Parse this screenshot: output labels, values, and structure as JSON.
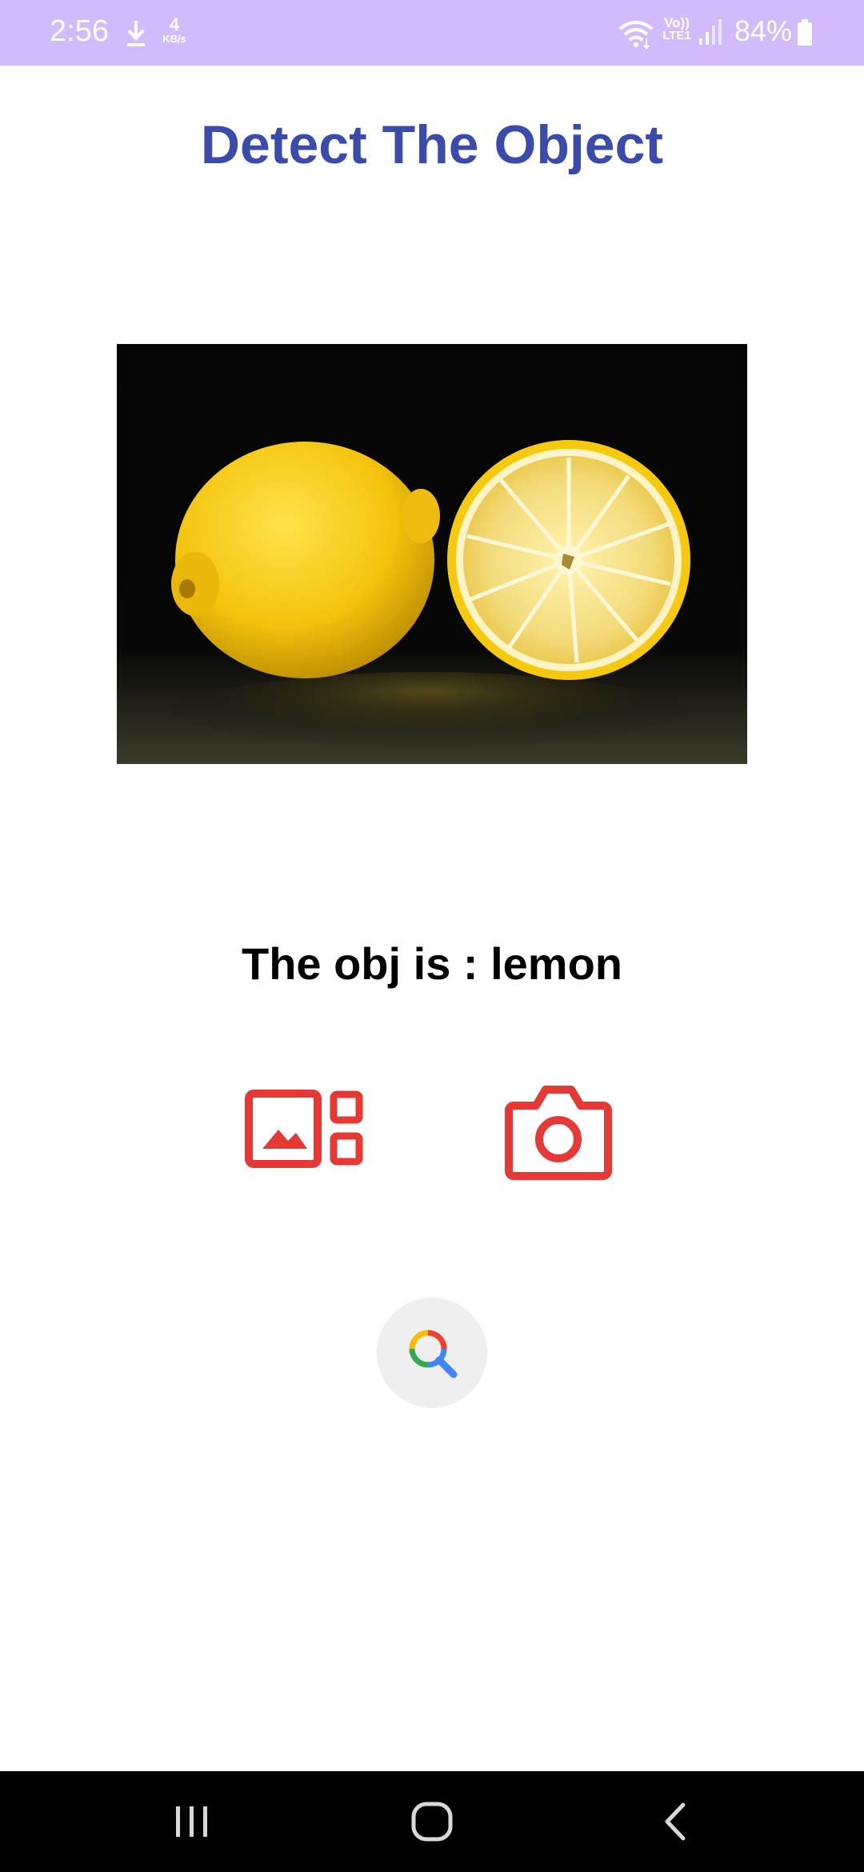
{
  "status_bar": {
    "time": "2:56",
    "speed_value": "4",
    "speed_unit": "KB/s",
    "volte_top": "Vo))",
    "volte_bottom": "LTE1",
    "battery": "84%",
    "background_color": "#d0bcfc"
  },
  "header": {
    "title": "Detect The Object",
    "title_color": "#3a4bab"
  },
  "main": {
    "image_subject": "lemon-photo",
    "result_text": "The obj is : lemon",
    "gallery_icon": "gallery-icon",
    "camera_icon": "camera-icon",
    "search_icon": "search-icon",
    "accent_color": "#e53935"
  },
  "nav_bar": {
    "recents_icon": "recents-icon",
    "home_icon": "home-icon",
    "back_icon": "back-icon"
  }
}
